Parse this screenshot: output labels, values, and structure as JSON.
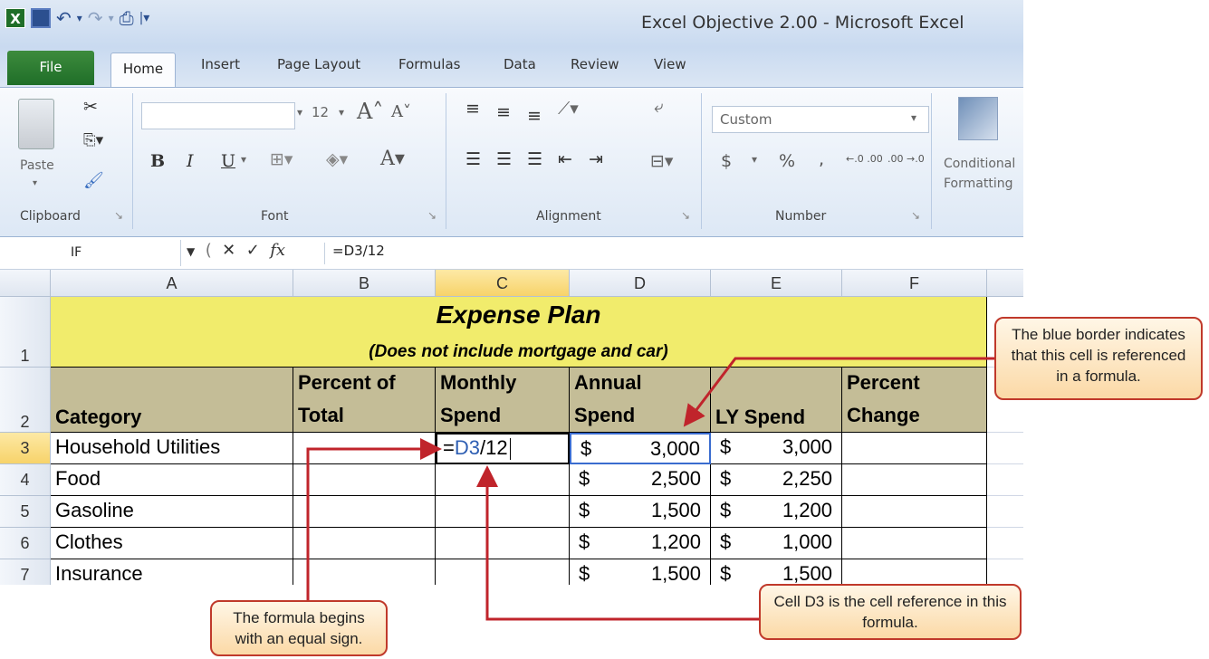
{
  "window": {
    "title": "Excel Objective 2.00 - Microsoft Excel"
  },
  "quick_access": {
    "icons": [
      "excel-logo-icon",
      "save-icon",
      "undo-icon",
      "redo-icon",
      "print-icon",
      "customize-icon"
    ]
  },
  "tabs": [
    {
      "label": "File"
    },
    {
      "label": "Home"
    },
    {
      "label": "Insert"
    },
    {
      "label": "Page Layout"
    },
    {
      "label": "Formulas"
    },
    {
      "label": "Data"
    },
    {
      "label": "Review"
    },
    {
      "label": "View"
    }
  ],
  "ribbon": {
    "clipboard": {
      "label": "Clipboard",
      "paste_label": "Paste"
    },
    "font": {
      "label": "Font",
      "size": "12",
      "bold": "B",
      "italic": "I",
      "underline": "U"
    },
    "alignment": {
      "label": "Alignment"
    },
    "number": {
      "label": "Number",
      "format": "Custom",
      "currency": "$",
      "percent": "%",
      "comma": ",",
      "inc_decimal": "←.0 .00",
      "dec_decimal": ".00 →.0"
    },
    "styles": {
      "conditional_line1": "Conditional",
      "conditional_line2": "Formatting"
    }
  },
  "formula_bar": {
    "name_box": "IF",
    "formula": "=D3/12"
  },
  "columns": [
    "A",
    "B",
    "C",
    "D",
    "E",
    "F",
    "C"
  ],
  "rows": [
    "1",
    "2",
    "3",
    "4",
    "5",
    "6",
    "7"
  ],
  "sheet": {
    "title": "Expense Plan",
    "subtitle": "(Does not include mortgage and car)",
    "headers": {
      "category": "Category",
      "percent_of_total": [
        "Percent of",
        "Total"
      ],
      "monthly_spend": [
        "Monthly",
        "Spend"
      ],
      "annual_spend": [
        "Annual",
        "Spend"
      ],
      "ly_spend": "LY Spend",
      "percent_change": [
        "Percent",
        "Change"
      ]
    },
    "data_rows": [
      {
        "category": "Household Utilities",
        "monthly": "=D3/12",
        "annual": "3,000",
        "ly": "3,000"
      },
      {
        "category": "Food",
        "monthly": "",
        "annual": "2,500",
        "ly": "2,250"
      },
      {
        "category": "Gasoline",
        "monthly": "",
        "annual": "1,500",
        "ly": "1,200"
      },
      {
        "category": "Clothes",
        "monthly": "",
        "annual": "1,200",
        "ly": "1,000"
      },
      {
        "category": "Insurance",
        "monthly": "",
        "annual": "1,500",
        "ly": "1,500"
      }
    ],
    "currency_symbol": "$",
    "formula_parts": {
      "equals": "=",
      "ref": "D3",
      "rest": "/12"
    }
  },
  "callouts": {
    "blue_border": "The blue border indicates that this cell is referenced in a formula.",
    "equal_sign": "The formula begins with an equal sign.",
    "cell_reference": "Cell D3 is the cell reference in this formula."
  },
  "colors": {
    "header_fill": "#c4bd97",
    "title_fill": "#f1ec6c",
    "arrow": "#c0242b",
    "ref_blue": "#2f5fb3"
  }
}
